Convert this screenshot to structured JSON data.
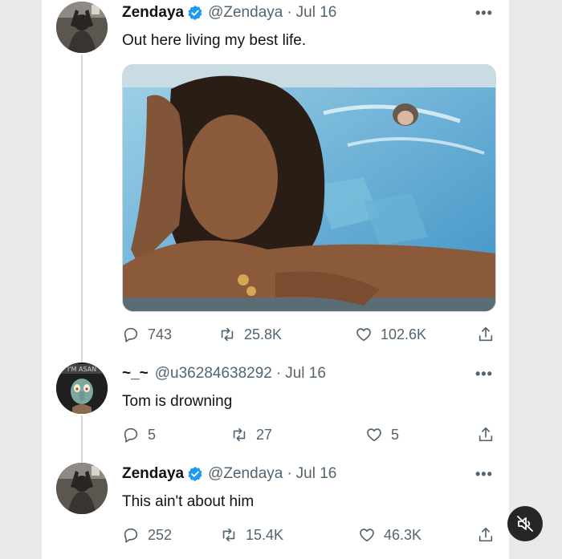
{
  "tweets": [
    {
      "name": "Zendaya",
      "handle": "@Zendaya",
      "date": "Jul 16",
      "text": "Out here living my best life.",
      "replies": "743",
      "retweets": "25.8K",
      "likes": "102.6K",
      "verified": true
    },
    {
      "name": "~_~",
      "handle": "@u36284638292",
      "date": "Jul 16",
      "text": "Tom is drowning",
      "replies": "5",
      "retweets": "27",
      "likes": "5",
      "verified": false
    },
    {
      "name": "Zendaya",
      "handle": "@Zendaya",
      "date": "Jul 16",
      "text": "This ain't about him",
      "replies": "252",
      "retweets": "15.4K",
      "likes": "46.3K",
      "verified": true
    }
  ],
  "separator": "·",
  "more_glyph": "•••",
  "icons": {
    "reply": "reply-icon",
    "retweet": "retweet-icon",
    "like": "heart-icon",
    "share": "share-icon",
    "verified": "verified-badge-icon",
    "mute": "muted-speaker-icon"
  },
  "colors": {
    "text": "#0f1419",
    "muted": "#536471",
    "verified": "#1d9bf0",
    "pool": "#5fb3d8"
  }
}
